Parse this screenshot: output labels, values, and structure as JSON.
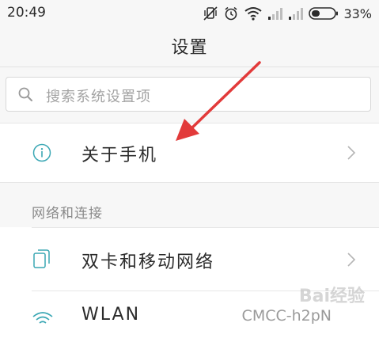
{
  "status_bar": {
    "time": "20:49",
    "battery_percent": "33%",
    "icons": [
      "vibrate-off-icon",
      "alarm-icon",
      "wifi-icon",
      "signal-icon",
      "signal-icon",
      "battery-icon"
    ]
  },
  "header": {
    "title": "设置"
  },
  "search": {
    "placeholder": "搜索系统设置项"
  },
  "rows": {
    "about": {
      "label": "关于手机",
      "icon": "info-icon"
    },
    "dual_sim": {
      "label": "双卡和移动网络",
      "icon": "sim-card-icon"
    },
    "wlan": {
      "label": "WLAN",
      "value": "CMCC-h2pN",
      "icon": "wifi-icon"
    }
  },
  "sections": {
    "network": "网络和连接"
  },
  "watermark": "Bai经验",
  "colors": {
    "background": "#f7f7f7",
    "row_background": "#ffffff",
    "accent_icon": "#3aa7b4",
    "annotation_arrow": "#e23a3a"
  }
}
